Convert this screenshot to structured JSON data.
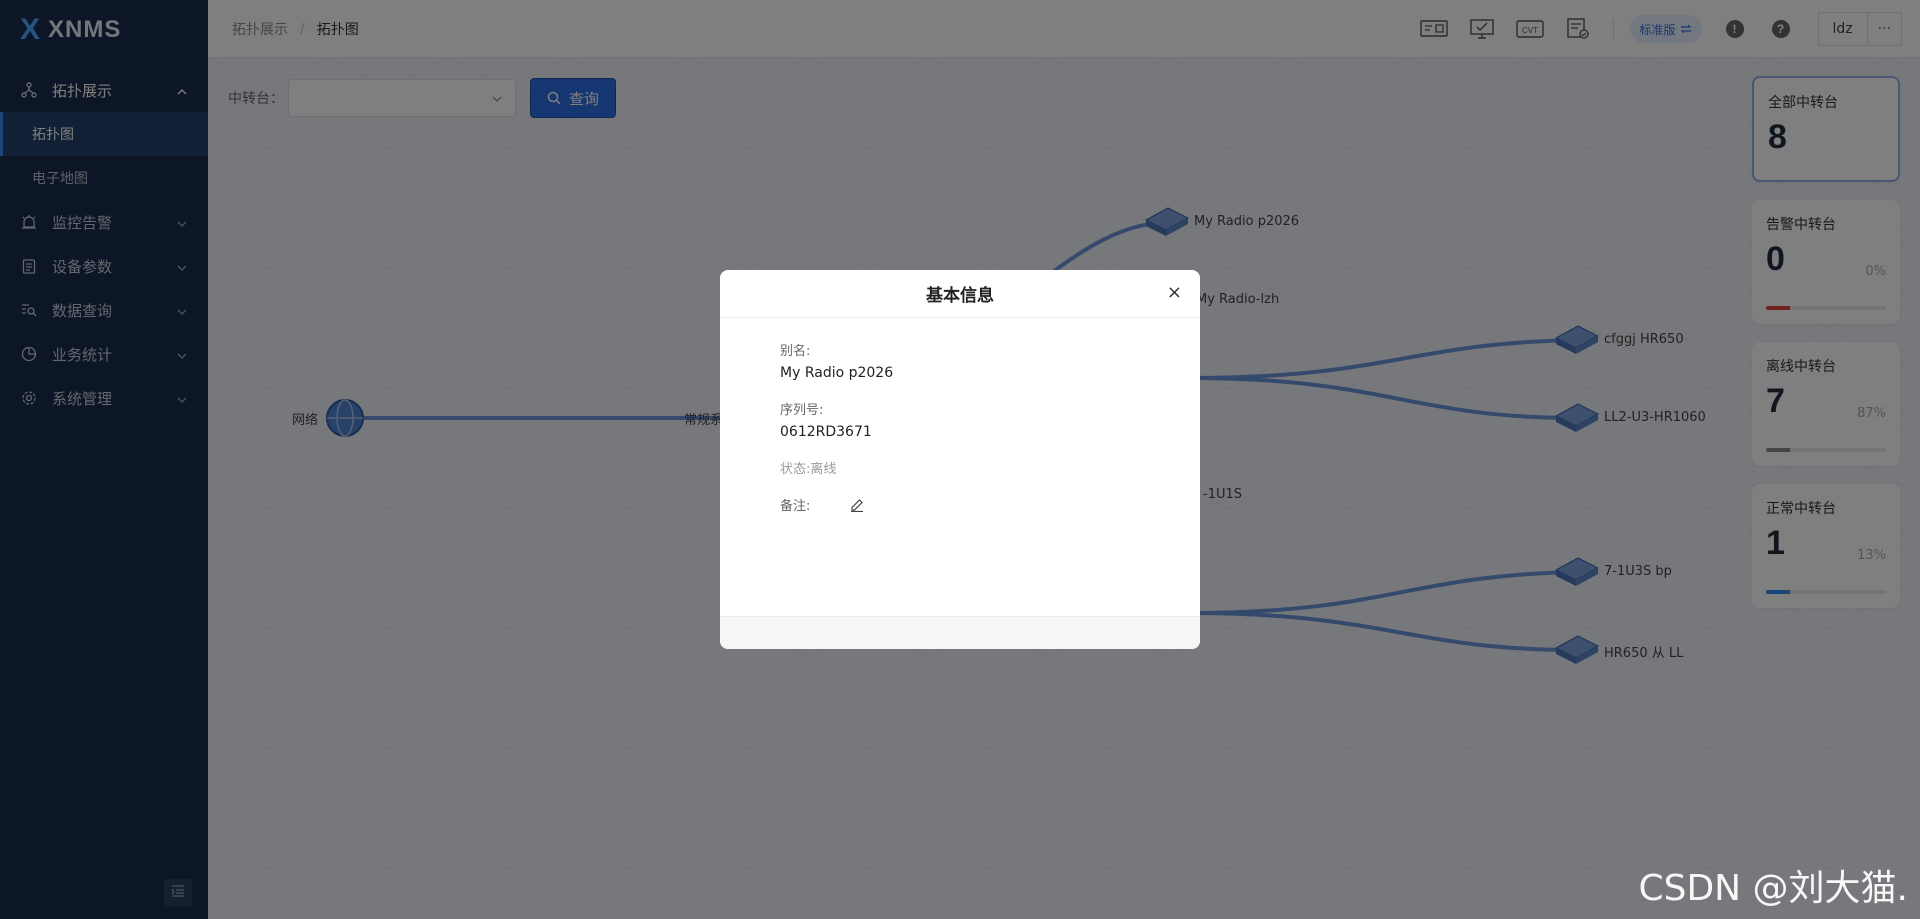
{
  "app": {
    "logo_mark": "X",
    "name": "XNMS"
  },
  "sidebar": {
    "groups": [
      {
        "label": "拓扑展示",
        "icon": "topology-icon",
        "open": true,
        "items": [
          {
            "label": "拓扑图",
            "active": true
          },
          {
            "label": "电子地图",
            "active": false
          }
        ]
      },
      {
        "label": "监控告警",
        "icon": "alarm-icon"
      },
      {
        "label": "设备参数",
        "icon": "clipboard-icon"
      },
      {
        "label": "数据查询",
        "icon": "search-list-icon"
      },
      {
        "label": "业务统计",
        "icon": "pie-chart-icon"
      },
      {
        "label": "系统管理",
        "icon": "gear-icon"
      }
    ]
  },
  "breadcrumb": {
    "parent": "拓扑展示",
    "separator": "/",
    "current": "拓扑图"
  },
  "header": {
    "edition_label": "标准版",
    "user": "ldz",
    "more": "···"
  },
  "filter": {
    "label": "中转台：",
    "select_value": "",
    "query_label": "查询"
  },
  "topology": {
    "labels": {
      "network": "网络",
      "conventional": "常规系",
      "radio_p2026": "My Radio p2026",
      "radio_lzh": "My Radio-lzh",
      "cfggj": "cfggj  HR650",
      "ll2": "LL2-U3-HR1060",
      "u1s": "-1U1S",
      "u3s": "7-1U3S bp",
      "hr650": "HR650 从 LL"
    }
  },
  "stats": {
    "cards": [
      {
        "title": "全部中转台",
        "value": "8"
      },
      {
        "title": "告警中转台",
        "value": "0",
        "percent": "0%",
        "fill": 0.2,
        "color": "#e0443a"
      },
      {
        "title": "离线中转台",
        "value": "7",
        "percent": "87%",
        "fill": 0.2,
        "color": "#888888"
      },
      {
        "title": "正常中转台",
        "value": "1",
        "percent": "13%",
        "fill": 0.2,
        "color": "#2a8ff0"
      }
    ]
  },
  "modal": {
    "title": "基本信息",
    "close": "×",
    "alias_label": "别名:",
    "alias_value": "My Radio p2026",
    "serial_label": "序列号:",
    "serial_value": "0612RD3671",
    "status_text": "状态:离线",
    "remark_label": "备注:"
  },
  "watermark": "CSDN @刘大猫."
}
